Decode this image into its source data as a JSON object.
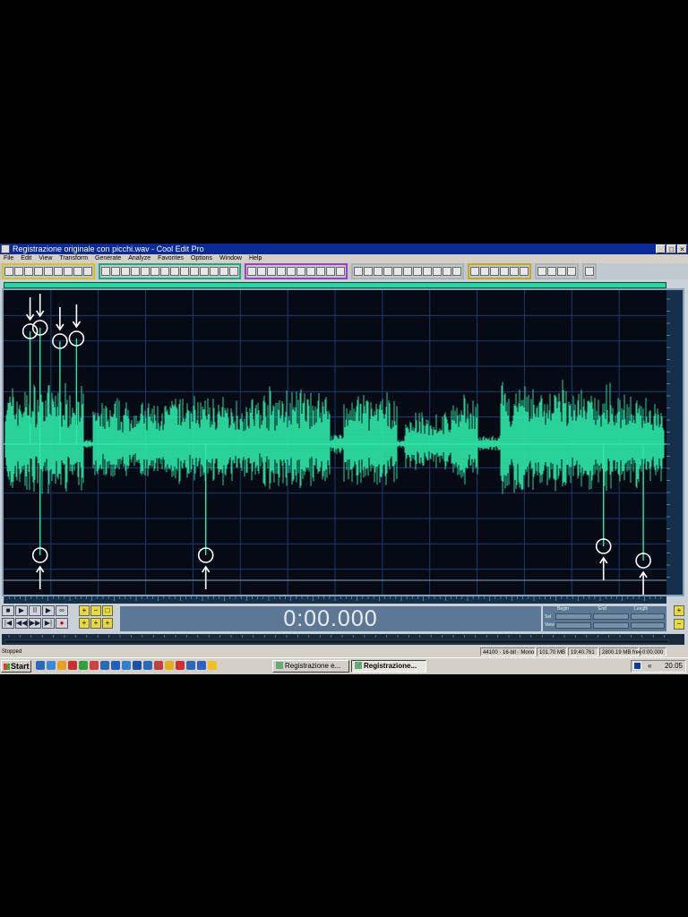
{
  "window": {
    "title": "Registrazione originale con picchi.wav - Cool Edit Pro",
    "minimize_glyph": "_",
    "maximize_glyph": "□",
    "close_glyph": "×"
  },
  "menu": [
    "File",
    "Edit",
    "View",
    "Transform",
    "Generate",
    "Analyze",
    "Favorites",
    "Options",
    "Window",
    "Help"
  ],
  "toolbar_groups": [
    {
      "name": "file",
      "color": "#d8c020",
      "buttons": 9
    },
    {
      "name": "edit",
      "color": "#20a878",
      "buttons": 14
    },
    {
      "name": "effects",
      "color": "#a040c0",
      "buttons": 10
    },
    {
      "name": "analysis",
      "color": "#b0b0b0",
      "buttons": 11
    },
    {
      "name": "view",
      "color": "#c8a820",
      "buttons": 6
    },
    {
      "name": "multitrack",
      "color": "#b0b0b0",
      "buttons": 4
    },
    {
      "name": "extra",
      "color": "#b0b0b0",
      "buttons": 1
    }
  ],
  "waveform": {
    "color": "#2ee8a8",
    "background": "#050a14",
    "grid_color": "#1c3c6c",
    "annotation_color": "#ffffff",
    "peaks_top": [
      0.04,
      0.055,
      0.085,
      0.11
    ],
    "peaks_bottom": [
      0.055,
      0.305,
      0.905,
      0.965
    ]
  },
  "time_display": "0:00.000",
  "selection_panel": {
    "headers": [
      "Begin",
      "End",
      "Length"
    ],
    "rows": [
      "Sel",
      "View"
    ]
  },
  "transport": {
    "row1": [
      "■",
      "▶",
      "II",
      "▶",
      "∞"
    ],
    "row2": [
      "|◀",
      "◀◀",
      "▶▶",
      "▶|",
      "●"
    ],
    "zoom1": [
      "+",
      "−",
      "□"
    ],
    "zoom2": [
      "+",
      "+",
      "+"
    ]
  },
  "statusbar": {
    "state": "Stopped",
    "sample_format": "44100 · 16-bit · Mono",
    "file_size": "101.70 MB",
    "duration": "19:40.761",
    "free_space": "2800.19 MB free",
    "time": "0:00.000"
  },
  "taskbar": {
    "start_label": "Start",
    "tasks": [
      {
        "label": "Registrazione e...",
        "active": false
      },
      {
        "label": "Registrazione...",
        "active": true
      }
    ],
    "chevron": "«",
    "clock": "20.05",
    "quick_launch_colors": [
      "#2a6ab8",
      "#3a8ad8",
      "#e8a020",
      "#c83030",
      "#30a040",
      "#d04040",
      "#2a6ab8",
      "#2060c0",
      "#3080d0",
      "#1a50a8",
      "#2a6ab8",
      "#c04040",
      "#e0b020",
      "#d03030",
      "#2a6ab8",
      "#3060c0",
      "#f0c020"
    ]
  }
}
